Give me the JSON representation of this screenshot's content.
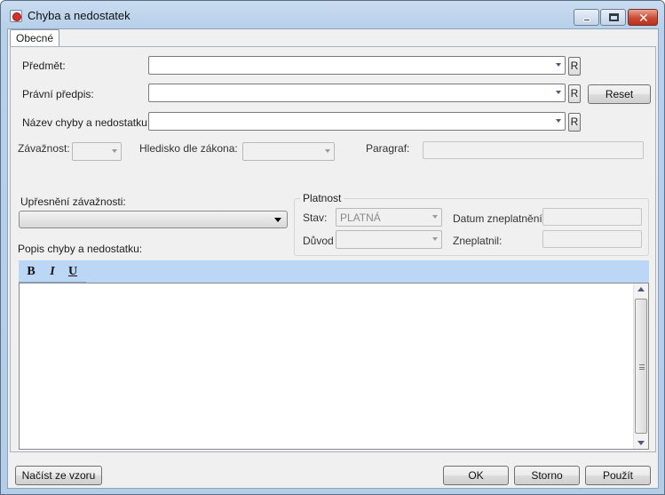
{
  "window": {
    "title": "Chyba a nedostatek"
  },
  "tabs": [
    {
      "label": "Obecné"
    }
  ],
  "form": {
    "predmet_label": "Předmět:",
    "pravni_predpis_label": "Právní předpis:",
    "nazev_label": "Název chyby a nedostatku:",
    "r_label": "R",
    "reset_label": "Reset",
    "zavaznost_label": "Závažnost:",
    "hledisko_label": "Hledisko dle zákona:",
    "paragraf_label": "Paragraf:",
    "upresneni_label": "Upřesnění závažnosti:",
    "popis_label": "Popis chyby a nedostatku:"
  },
  "platnost": {
    "group_title": "Platnost",
    "stav_label": "Stav:",
    "stav_value": "PLATNÁ",
    "duvod_label": "Důvod",
    "datum_label": "Datum zneplatnění:",
    "zneplatnil_label": "Zneplatnil:"
  },
  "editor_toolbar": {
    "bold": "B",
    "italic": "I",
    "underline": "U"
  },
  "footer": {
    "load_template_label": "Načíst ze vzoru",
    "ok_label": "OK",
    "cancel_label": "Storno",
    "apply_label": "Použít"
  },
  "colors": {
    "title_gradient": "#b8d0ea",
    "toolbar_bg": "#bcd6f5",
    "close_button": "#c94b34"
  }
}
